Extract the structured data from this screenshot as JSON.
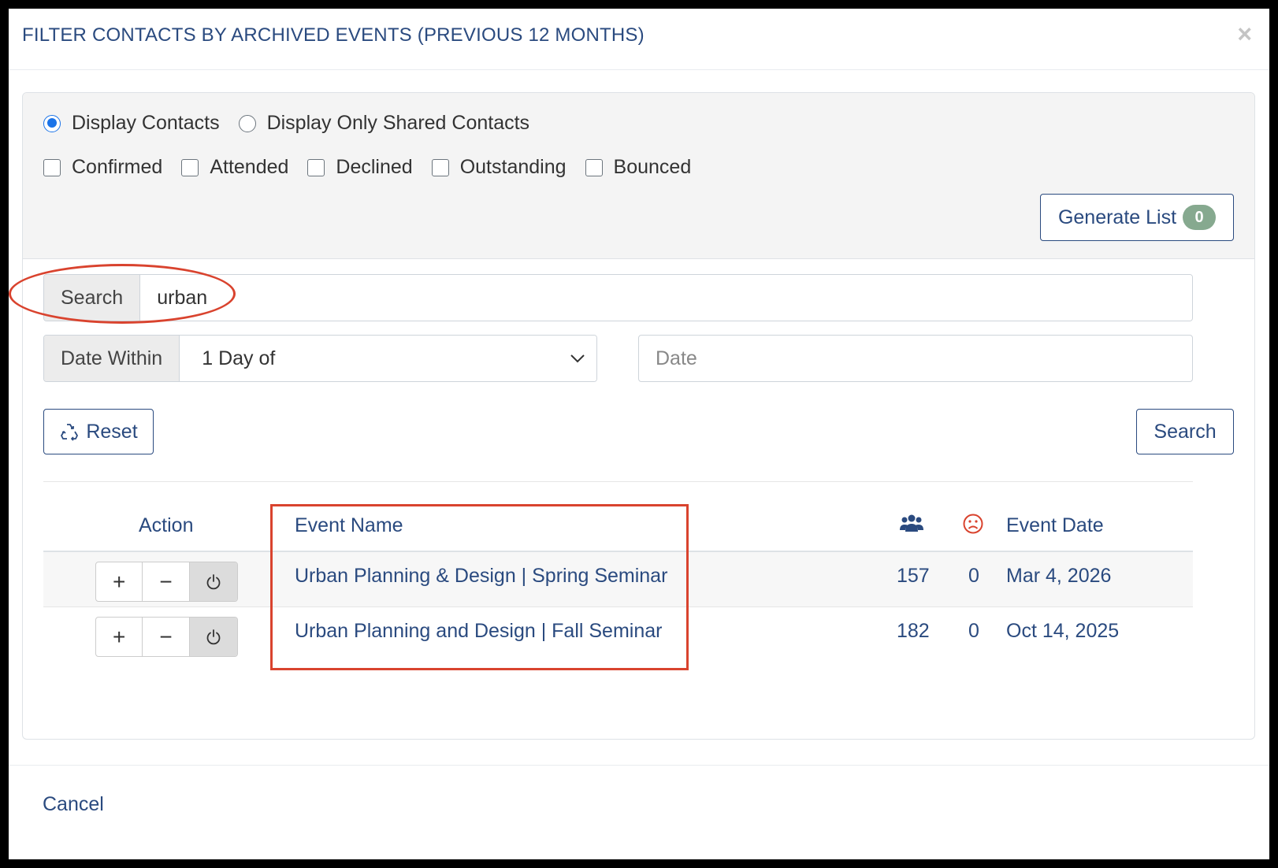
{
  "modal": {
    "title": "FILTER CONTACTS BY ARCHIVED EVENTS (PREVIOUS 12 MONTHS)",
    "close_label": "×"
  },
  "display_options": [
    {
      "label": "Display Contacts",
      "checked": true
    },
    {
      "label": "Display Only Shared Contacts",
      "checked": false
    }
  ],
  "status_filters": [
    {
      "label": "Confirmed",
      "checked": false
    },
    {
      "label": "Attended",
      "checked": false
    },
    {
      "label": "Declined",
      "checked": false
    },
    {
      "label": "Outstanding",
      "checked": false
    },
    {
      "label": "Bounced",
      "checked": false
    }
  ],
  "generate": {
    "label": "Generate List",
    "count": "0"
  },
  "search": {
    "addon_label": "Search",
    "value": "urban"
  },
  "date_within": {
    "addon_label": "Date Within",
    "selected": "1 Day of",
    "date_placeholder": "Date"
  },
  "buttons": {
    "reset": "Reset",
    "search": "Search",
    "cancel": "Cancel"
  },
  "table": {
    "headers": {
      "action": "Action",
      "event_name": "Event Name",
      "event_date": "Event Date"
    },
    "rows": [
      {
        "name": "Urban Planning & Design | Spring Seminar",
        "attendees": "157",
        "bounced": "0",
        "date": "Mar 4, 2026"
      },
      {
        "name": "Urban Planning and Design | Fall Seminar",
        "attendees": "182",
        "bounced": "0",
        "date": "Oct 14, 2025"
      }
    ],
    "action_buttons": {
      "add": "+",
      "remove": "−"
    }
  },
  "colors": {
    "primary": "#2a4a7f",
    "highlight": "#d9432e",
    "badge": "#86a98f",
    "sad_icon": "#d9432e"
  }
}
